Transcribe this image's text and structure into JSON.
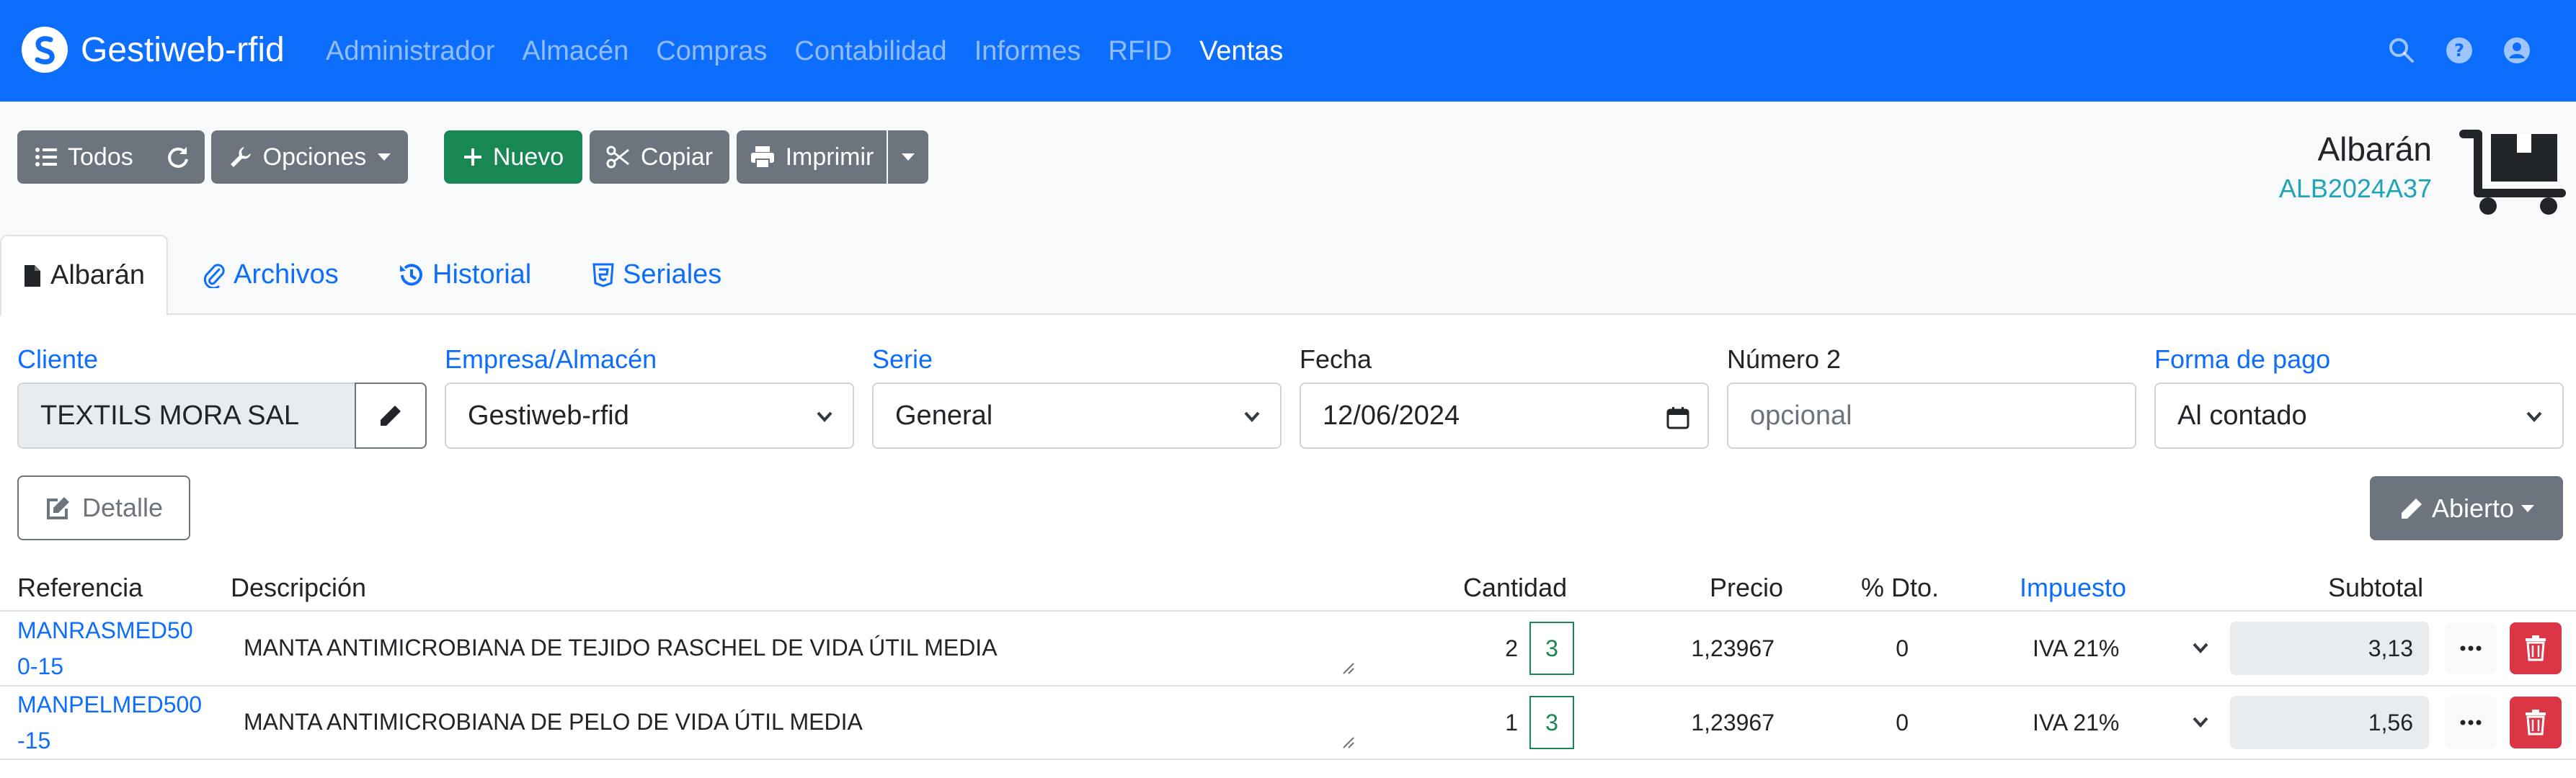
{
  "navbar": {
    "brand": "Gestiweb-rfid",
    "links": [
      "Administrador",
      "Almacén",
      "Compras",
      "Contabilidad",
      "Informes",
      "RFID",
      "Ventas"
    ],
    "active": "Ventas",
    "icons": [
      "search-icon",
      "help-icon",
      "user-icon"
    ]
  },
  "toolbar": {
    "todos_label": "Todos",
    "opciones_label": "Opciones",
    "nuevo_label": "Nuevo",
    "copiar_label": "Copiar",
    "imprimir_label": "Imprimir"
  },
  "document": {
    "type": "Albarán",
    "code": "ALB2024A37"
  },
  "tabs": [
    {
      "label": "Albarán",
      "icon": "file-icon"
    },
    {
      "label": "Archivos",
      "icon": "paperclip-icon"
    },
    {
      "label": "Historial",
      "icon": "history-icon"
    },
    {
      "label": "Seriales",
      "icon": "html5-icon"
    }
  ],
  "form": {
    "cliente": {
      "label": "Cliente",
      "value": "TEXTILS MORA SAL"
    },
    "empresa": {
      "label": "Empresa/Almacén",
      "value": "Gestiweb-rfid"
    },
    "serie": {
      "label": "Serie",
      "value": "General"
    },
    "fecha": {
      "label": "Fecha",
      "value": "12/06/2024"
    },
    "numero2": {
      "label": "Número 2",
      "placeholder": "opcional"
    },
    "forma_pago": {
      "label": "Forma de pago",
      "value": "Al contado"
    }
  },
  "actions": {
    "detalle_label": "Detalle",
    "abierto_label": "Abierto"
  },
  "table": {
    "headers": {
      "referencia": "Referencia",
      "descripcion": "Descripción",
      "cantidad": "Cantidad",
      "precio": "Precio",
      "dto": "% Dto.",
      "impuesto": "Impuesto",
      "subtotal": "Subtotal"
    },
    "rows": [
      {
        "ref_line1": "MANRASMED50",
        "ref_line2": "0-15",
        "descripcion": "MANTA ANTIMICROBIANA DE TEJIDO RASCHEL DE VIDA ÚTIL MEDIA",
        "cantidad": "2",
        "cantidad_box": "3",
        "precio": "1,23967",
        "dto": "0",
        "impuesto": "IVA 21%",
        "subtotal": "3,13"
      },
      {
        "ref_line1": "MANPELMED500",
        "ref_line2": "-15",
        "descripcion": "MANTA ANTIMICROBIANA DE PELO DE VIDA ÚTIL MEDIA",
        "cantidad": "1",
        "cantidad_box": "3",
        "precio": "1,23967",
        "dto": "0",
        "impuesto": "IVA 21%",
        "subtotal": "1,56"
      }
    ]
  },
  "colors": {
    "primary": "#0d6efd",
    "secondary": "#6c757d",
    "success": "#198754",
    "danger": "#dc3545",
    "info": "#20a4b8"
  }
}
